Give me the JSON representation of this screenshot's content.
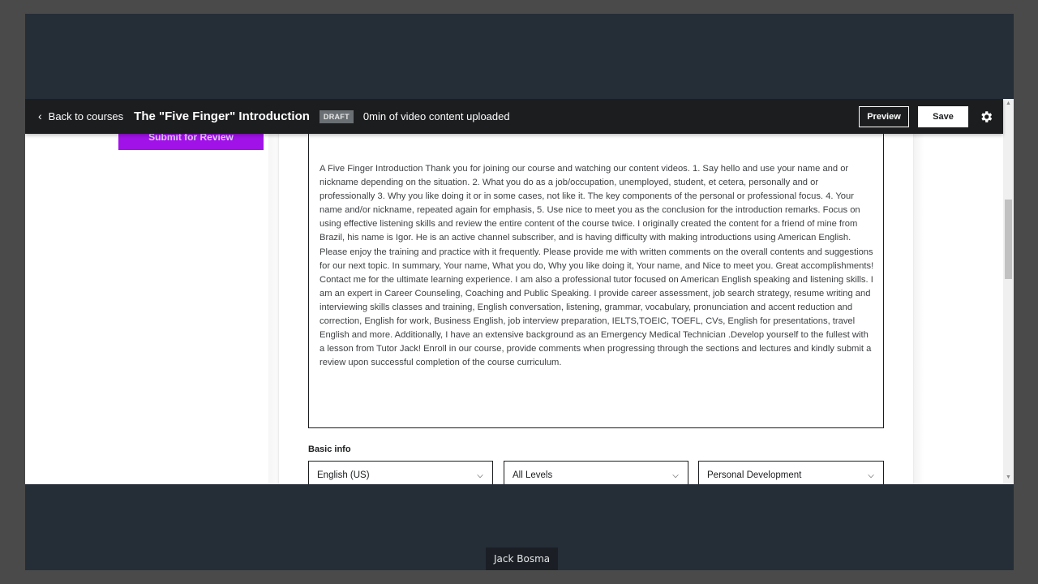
{
  "topbar": {
    "back_label": "Back to courses",
    "course_title": "The \"Five Finger\" Introduction",
    "status_badge": "DRAFT",
    "upload_status": "0min of video content uploaded",
    "preview_label": "Preview",
    "save_label": "Save",
    "settings_icon": "gear-icon",
    "back_icon": "chevron-left-icon"
  },
  "sidebar": {
    "submit_label": "Submit for Review",
    "submit_color": "#a012e8"
  },
  "description": {
    "text": "A Five Finger Introduction Thank you for joining our course and watching our content videos. 1. Say hello and use your name and or nickname depending on the situation. 2. What you do as a job/occupation, unemployed, student, et cetera, personally and or professionally 3. Why you like doing it or in some cases, not like it. The key components of the personal or professional focus. 4. Your name and/or nickname, repeated again for emphasis, 5. Use nice to meet you as the conclusion for the introduction remarks. Focus on using effective listening skills and review the entire content of the course twice. I originally created the content for a friend of mine from Brazil, his name is Igor. He is an active channel subscriber, and is having difficulty with making introductions using American English. Please enjoy the training and practice with it frequently. Please provide me with written comments on the overall contents and suggestions for our next topic. In summary, Your name, What you do, Why you like doing it, Your name, and Nice to meet you. Great accomplishments! Contact me for the ultimate learning experience. I am also a professional tutor focused on American English speaking and listening skills. I am an expert in Career Counseling, Coaching and Public Speaking. I provide career assessment, job search strategy, resume writing and interviewing skills classes and training, English conversation, listening, grammar, vocabulary, pronunciation and accent reduction and correction, English for work, Business English, job interview preparation, IELTS,TOEIC, TOEFL, CVs, English for presentations, travel English and more. Additionally, I have an extensive background as an Emergency Medical Technician .Develop yourself to the fullest with a lesson from Tutor Jack! Enroll in our course, provide comments when progressing through the sections and lectures and kindly submit a review upon successful completion of the course curriculum."
  },
  "basic_info": {
    "label": "Basic info",
    "language": "English (US)",
    "level": "All Levels",
    "category": "Personal Development",
    "caret_icon": "chevron-down-icon"
  },
  "caption": {
    "text": "Jack Bosma"
  }
}
